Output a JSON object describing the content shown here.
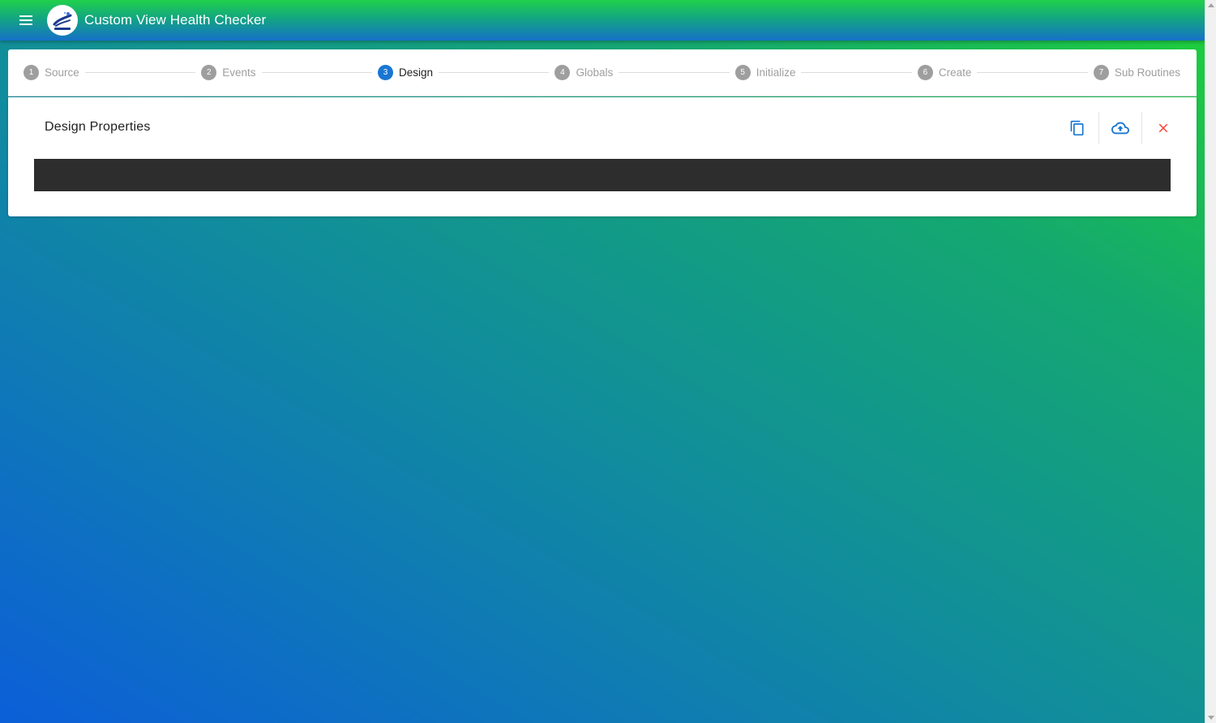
{
  "app": {
    "title": "Custom View Health Checker",
    "logo_icon": "app-logo-icon",
    "menu_icon": "hamburger-menu-icon"
  },
  "stepper": {
    "steps": [
      {
        "number": "1",
        "label": "Source",
        "active": false
      },
      {
        "number": "2",
        "label": "Events",
        "active": false
      },
      {
        "number": "3",
        "label": "Design",
        "active": true
      },
      {
        "number": "4",
        "label": "Globals",
        "active": false
      },
      {
        "number": "5",
        "label": "Initialize",
        "active": false
      },
      {
        "number": "6",
        "label": "Create",
        "active": false
      },
      {
        "number": "7",
        "label": "Sub Routines",
        "active": false
      }
    ]
  },
  "card": {
    "title": "Design Properties",
    "actions": [
      {
        "icon": "copy-icon",
        "color": "#1976d2"
      },
      {
        "icon": "cloud-upload-icon",
        "color": "#1976d2"
      },
      {
        "icon": "close-icon",
        "color": "#f44336"
      }
    ]
  },
  "colors": {
    "accent": "#1976d2",
    "danger": "#f44336",
    "inactive": "#9e9e9e",
    "editor_bg": "#2d2d2d"
  }
}
